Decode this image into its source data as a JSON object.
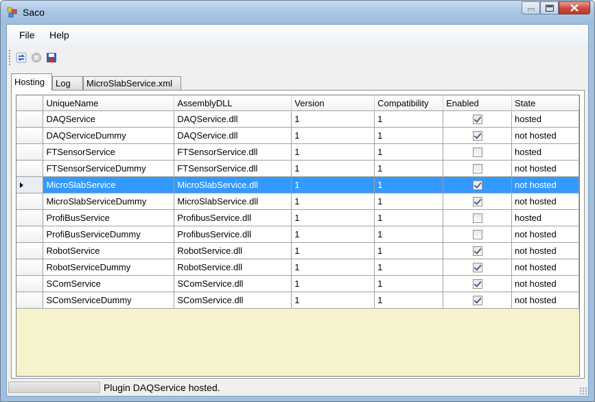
{
  "window": {
    "title": "Saco"
  },
  "menu": {
    "items": [
      "File",
      "Help"
    ]
  },
  "toolbar": {
    "refresh_icon": "refresh-icon",
    "stop_icon": "stop-icon",
    "save_icon": "save-icon"
  },
  "tabs": [
    "Hosting",
    "Log",
    "MicroSlabService.xml"
  ],
  "grid": {
    "columns": [
      "UniqueName",
      "AssemblyDLL",
      "Version",
      "Compatibility",
      "Enabled",
      "State"
    ],
    "rows": [
      {
        "name": "DAQService",
        "dll": "DAQService.dll",
        "version": "1",
        "compat": "1",
        "enabled": true,
        "state": "hosted"
      },
      {
        "name": "DAQServiceDummy",
        "dll": "DAQService.dll",
        "version": "1",
        "compat": "1",
        "enabled": true,
        "state": "not hosted"
      },
      {
        "name": "FTSensorService",
        "dll": "FTSensorService.dll",
        "version": "1",
        "compat": "1",
        "enabled": false,
        "state": "hosted"
      },
      {
        "name": "FTSensorServiceDummy",
        "dll": "FTSensorService.dll",
        "version": "1",
        "compat": "1",
        "enabled": false,
        "state": "not hosted"
      },
      {
        "name": "MicroSlabService",
        "dll": "MicroSlabService.dll",
        "version": "1",
        "compat": "1",
        "enabled": true,
        "state": "not hosted",
        "selected": true
      },
      {
        "name": "MicroSlabServiceDummy",
        "dll": "MicroSlabService.dll",
        "version": "1",
        "compat": "1",
        "enabled": true,
        "state": "not hosted"
      },
      {
        "name": "ProfiBusService",
        "dll": "ProfibusService.dll",
        "version": "1",
        "compat": "1",
        "enabled": false,
        "state": "hosted"
      },
      {
        "name": "ProfiBusServiceDummy",
        "dll": "ProfibusService.dll",
        "version": "1",
        "compat": "1",
        "enabled": false,
        "state": "not hosted"
      },
      {
        "name": "RobotService",
        "dll": "RobotService.dll",
        "version": "1",
        "compat": "1",
        "enabled": true,
        "state": "not hosted"
      },
      {
        "name": "RobotServiceDummy",
        "dll": "RobotService.dll",
        "version": "1",
        "compat": "1",
        "enabled": true,
        "state": "not hosted"
      },
      {
        "name": "SComService",
        "dll": "SComService.dll",
        "version": "1",
        "compat": "1",
        "enabled": true,
        "state": "not hosted"
      },
      {
        "name": "SComServiceDummy",
        "dll": "SComService.dll",
        "version": "1",
        "compat": "1",
        "enabled": true,
        "state": "not hosted"
      }
    ]
  },
  "status": {
    "message": "Plugin DAQService hosted."
  }
}
